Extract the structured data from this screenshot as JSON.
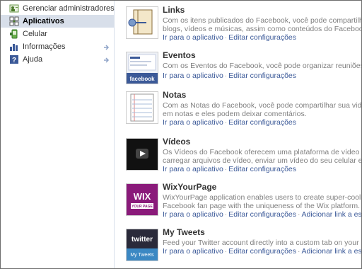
{
  "sidebar": {
    "items": [
      {
        "label": "Gerenciar administradores",
        "icon": "admin-users-icon"
      },
      {
        "label": "Aplicativos",
        "icon": "apps-puzzle-icon",
        "active": true
      },
      {
        "label": "Celular",
        "icon": "mobile-icon"
      },
      {
        "label": "Informações",
        "icon": "stats-chart-icon",
        "arrow": true
      },
      {
        "label": "Ajuda",
        "icon": "help-question-icon",
        "arrow": true
      }
    ]
  },
  "apps": [
    {
      "title": "Links",
      "desc": [
        "Com os itens publicados do Facebook, você pode compartilhar qualquer",
        "blogs, vídeos e músicas, assim como conteúdos do Facebook, como pe"
      ],
      "links": [
        "Ir para o aplicativo",
        "Editar configurações"
      ]
    },
    {
      "title": "Eventos",
      "desc": [
        "Com os Eventos do Facebook, você pode organizar reuniões e festas c"
      ],
      "links": [
        "Ir para o aplicativo",
        "Editar configurações"
      ],
      "thumb_text": "facebook"
    },
    {
      "title": "Notas",
      "desc": [
        "Com as Notas do Facebook, você pode compartilhar sua vida com seus",
        "em notas e eles podem deixar comentários."
      ],
      "links": [
        "Ir para o aplicativo",
        "Editar configurações"
      ]
    },
    {
      "title": "Vídeos",
      "desc": [
        "Os Vídeos do Facebook oferecem uma plataforma de vídeo de alta qual",
        "carregar arquivos de vídeo, enviar um vídeo do seu celular e gravar m"
      ],
      "links": [
        "Ir para o aplicativo",
        "Editar configurações"
      ]
    },
    {
      "title": "WixYourPage",
      "desc": [
        "WixYourPage application enables users to create super-cool Facebook",
        "Facebook fan page with the uniqueness of the Wix platform."
      ],
      "links": [
        "Ir para o aplicativo",
        "Editar configurações",
        "Adicionar link a esta guia"
      ],
      "thumb_text": "WIX",
      "thumb_sub": "YOUR PAGE"
    },
    {
      "title": "My Tweets",
      "desc": [
        "Feed your Twitter account directly into a custom tab on your Page, Fa"
      ],
      "links": [
        "Ir para o aplicativo",
        "Editar configurações",
        "Adicionar link a esta guia"
      ],
      "thumb_text": "twitter",
      "thumb_sub": "My Tweets"
    }
  ],
  "colors": {
    "link": "#3b5998",
    "active_bg": "#d8dfea",
    "desc": "#808080"
  }
}
